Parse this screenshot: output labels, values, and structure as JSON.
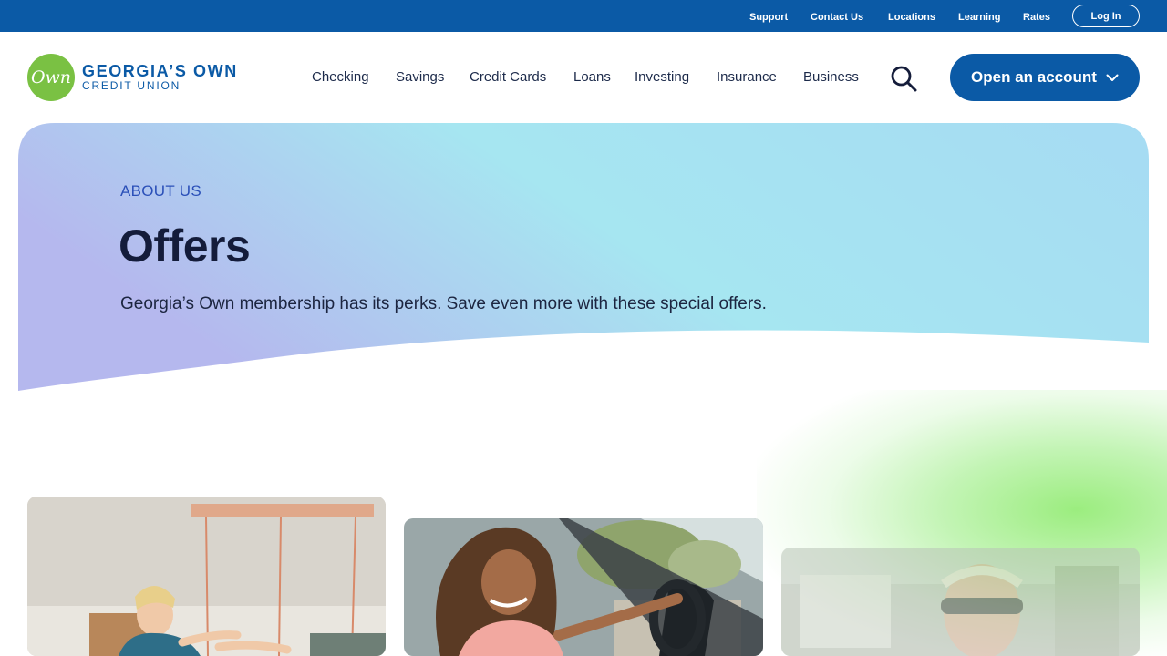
{
  "utility": {
    "links": [
      "Support",
      "Contact Us",
      "Locations",
      "Learning",
      "Rates"
    ],
    "login_label": "Log In"
  },
  "logo": {
    "mark": "Own",
    "line1": "GEORGIA’S OWN",
    "line2": "CREDIT UNION"
  },
  "nav": {
    "items": [
      "Checking",
      "Savings",
      "Credit Cards",
      "Loans",
      "Investing",
      "Insurance",
      "Business"
    ],
    "search_icon": "search-icon",
    "open_account_label": "Open an account",
    "open_account_icon": "chevron-down-icon"
  },
  "hero": {
    "eyebrow": "ABOUT US",
    "title": "Offers",
    "description": "Georgia’s Own membership has its perks. Save even more with these special offers."
  },
  "cards": [
    {
      "image": "woman-installing-light-fixture-photo"
    },
    {
      "image": "woman-driving-car-photo"
    },
    {
      "image": "man-with-sunglasses-photo"
    }
  ],
  "colors": {
    "brand_blue": "#0b5aa6",
    "brand_green": "#7ac143",
    "hero_gradient_start": "#b5b8ee",
    "hero_gradient_mid": "#a6e6f1",
    "hero_gradient_end": "#a6dbf3",
    "title_navy": "#141c3a",
    "eyebrow_blue": "#2a4fb8"
  }
}
